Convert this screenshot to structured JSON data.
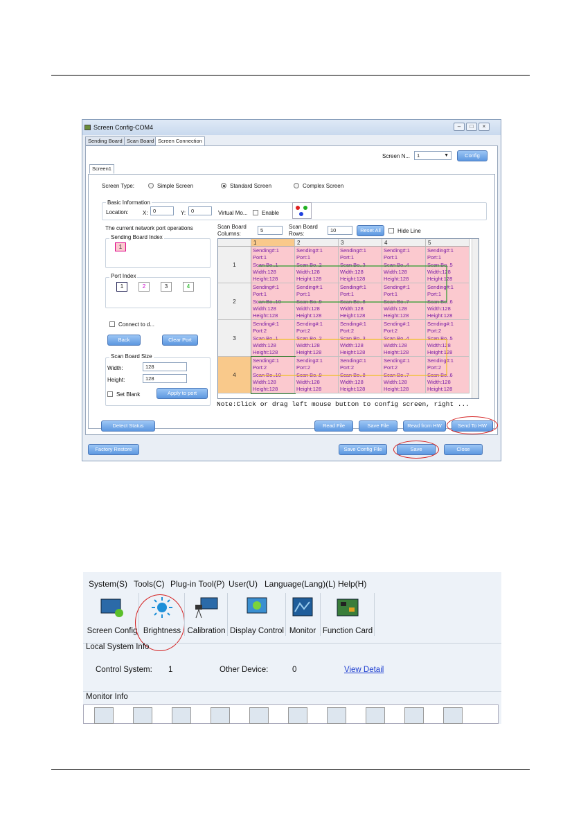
{
  "window1": {
    "title": "Screen Config-COM4",
    "tabs": [
      "Sending Board",
      "Scan Board",
      "Screen Connection"
    ],
    "screen_n_label": "Screen N...",
    "screen_n_value": "1",
    "config_btn": "Config",
    "screen_tab": "Screen1",
    "screen_type_label": "Screen Type:",
    "screen_types": [
      "Simple Screen",
      "Standard Screen",
      "Complex Screen"
    ],
    "basic_info_label": "Basic Information",
    "location_label": "Location:",
    "x_label": "X:",
    "x_value": "0",
    "y_label": "Y:",
    "y_value": "0",
    "virtual_label": "Virtual Mo...",
    "enable_label": "Enable",
    "port_ops_label": "The current network port operations",
    "sending_board_index_label": "Sending Board Index",
    "sending_board_index": "1",
    "port_index_label": "Port Index",
    "ports": [
      "1",
      "2",
      "3",
      "4"
    ],
    "connect_label": "Connect to d...",
    "back_btn": "Back",
    "clear_port_btn": "Clear Port",
    "scan_board_size_label": "Scan Board Size",
    "width_label": "Width:",
    "width_value": "128",
    "height_label": "Height:",
    "height_value": "128",
    "set_blank_label": "Set Blank",
    "apply_btn": "Apply to port",
    "scan_cols_label": "Scan Board Columns:",
    "scan_cols_value": "5",
    "scan_rows_label": "Scan Board Rows:",
    "scan_rows_value": "10",
    "reset_all_btn": "Reset All",
    "hide_line_label": "Hide Line",
    "columns": [
      "1",
      "2",
      "3",
      "4",
      "5"
    ],
    "rows": [
      {
        "label": "1",
        "cells": [
          [
            "Sending#:1",
            "Port:1",
            "Scan Bo..1",
            "Width:128",
            "Height:128"
          ],
          [
            "Sending#:1",
            "Port:1",
            "Scan Bo..2",
            "Width:128",
            "Height:128"
          ],
          [
            "Sending#:1",
            "Port:1",
            "Scan Bo..3",
            "Width:128",
            "Height:128"
          ],
          [
            "Sending#:1",
            "Port:1",
            "Scan Bo..4",
            "Width:128",
            "Height:128"
          ],
          [
            "Sending#:1",
            "Port:1",
            "Scan Bo..5",
            "Width:128",
            "Height:128"
          ]
        ]
      },
      {
        "label": "2",
        "cells": [
          [
            "Sending#:1",
            "Port:1",
            "Scan Bo..10",
            "Width:128",
            "Height:128"
          ],
          [
            "Sending#:1",
            "Port:1",
            "Scan Bo..9",
            "Width:128",
            "Height:128"
          ],
          [
            "Sending#:1",
            "Port:1",
            "Scan Bo..8",
            "Width:128",
            "Height:128"
          ],
          [
            "Sending#:1",
            "Port:1",
            "Scan Bo..7",
            "Width:128",
            "Height:128"
          ],
          [
            "Sending#:1",
            "Port:1",
            "Scan Bo..6",
            "Width:128",
            "Height:128"
          ]
        ]
      },
      {
        "label": "3",
        "cells": [
          [
            "Sending#:1",
            "Port:2",
            "Scan Bo..1",
            "Width:128",
            "Height:128"
          ],
          [
            "Sending#:1",
            "Port:2",
            "Scan Bo..2",
            "Width:128",
            "Height:128"
          ],
          [
            "Sending#:1",
            "Port:2",
            "Scan Bo..3",
            "Width:128",
            "Height:128"
          ],
          [
            "Sending#:1",
            "Port:2",
            "Scan Bo..4",
            "Width:128",
            "Height:128"
          ],
          [
            "Sending#:1",
            "Port:2",
            "Scan Bo..5",
            "Width:128",
            "Height:128"
          ]
        ]
      },
      {
        "label": "4",
        "cells": [
          [
            "Sending#:1",
            "Port:2",
            "Scan Bo..10",
            "Width:128",
            "Height:128"
          ],
          [
            "Sending#:1",
            "Port:2",
            "Scan Bo..9",
            "Width:128",
            "Height:128"
          ],
          [
            "Sending#:1",
            "Port:2",
            "Scan Bo..8",
            "Width:128",
            "Height:128"
          ],
          [
            "Sending#:1",
            "Port:2",
            "Scan Bo..7",
            "Width:128",
            "Height:128"
          ],
          [
            "Sending#:1",
            "Port:2",
            "Scan Bo..6",
            "Width:128",
            "Height:128"
          ]
        ]
      }
    ],
    "note": "Note:Click or drag left mouse button to config screen, right ...",
    "detect_btn": "Detect Status",
    "read_file_btn": "Read File",
    "save_file_btn": "Save File",
    "read_hw_btn": "Read from HW",
    "send_hw_btn": "Send To HW",
    "factory_btn": "Factory Restore",
    "save_config_btn": "Save Config File",
    "save_btn": "Save",
    "close_btn": "Close"
  },
  "window2": {
    "menu": [
      "System(S)",
      "Tools(C)",
      "Plug-in Tool(P)",
      "User(U)",
      "Language(Lang)(L)",
      "Help(H)"
    ],
    "tools": [
      {
        "label": "Screen Config",
        "icon": "screen-config-icon"
      },
      {
        "label": "Brightness",
        "icon": "brightness-icon"
      },
      {
        "label": "Calibration",
        "icon": "calibration-icon"
      },
      {
        "label": "Display Control",
        "icon": "display-control-icon"
      },
      {
        "label": "Monitor",
        "icon": "monitor-icon"
      },
      {
        "label": "Function Card",
        "icon": "function-card-icon"
      }
    ],
    "local_info_label": "Local System Info",
    "control_system_label": "Control System:",
    "control_system_value": "1",
    "other_device_label": "Other Device:",
    "other_device_value": "0",
    "view_detail": "View Detail",
    "monitor_info_label": "Monitor Info"
  }
}
